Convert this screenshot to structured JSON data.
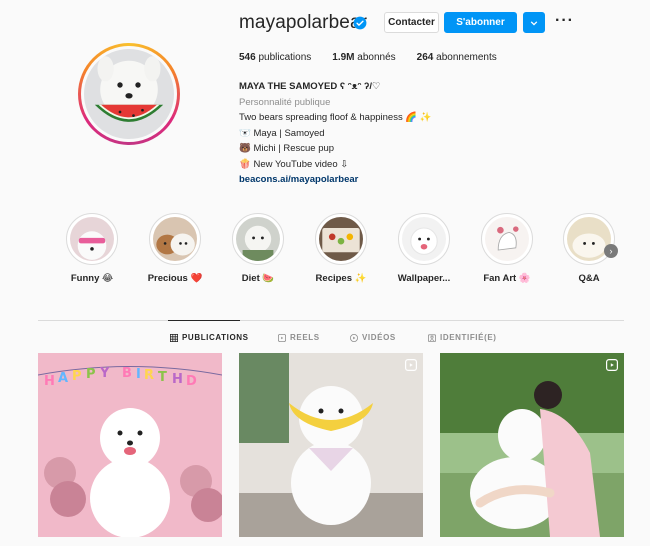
{
  "profile": {
    "username": "mayapolarbear",
    "contact_label": "Contacter",
    "follow_label": "S'abonner",
    "more_label": "···",
    "stats": [
      {
        "num": "546",
        "label": " publications"
      },
      {
        "num": "1.9M",
        "label": " abonnés"
      },
      {
        "num": "264",
        "label": " abonnements"
      }
    ],
    "bio": {
      "name": "MAYA THE SAMOYED ʕ ᵔᴥᵔ ʔ/♡",
      "category": "Personnalité publique",
      "lines": [
        "Two bears spreading floof & happiness 🌈 ✨",
        "🐻‍❄️ Maya | Samoyed",
        "🐻 Michi | Rescue pup",
        "🍿 New YouTube video ⇩"
      ],
      "link": "beacons.ai/mayapolarbear"
    }
  },
  "highlights": [
    {
      "label": "Funny 😂"
    },
    {
      "label": "Precious ❤️"
    },
    {
      "label": "Diet 🍉"
    },
    {
      "label": "Recipes ✨"
    },
    {
      "label": "Wallpaper..."
    },
    {
      "label": "Fan Art 🌸"
    },
    {
      "label": "Q&A"
    }
  ],
  "tabs": [
    {
      "label": "PUBLICATIONS",
      "icon": "grid-icon",
      "active": true
    },
    {
      "label": "REELS",
      "icon": "reels-icon"
    },
    {
      "label": "VIDÉOS",
      "icon": "video-icon"
    },
    {
      "label": "IDENTIFIÉ(E)",
      "icon": "tagged-icon"
    }
  ],
  "posts": [
    {
      "badge": null
    },
    {
      "badge": "reel-icon"
    },
    {
      "badge": "reel-icon"
    }
  ],
  "colors": {
    "accent": "#0095f6",
    "text": "#262626",
    "muted": "#8e8e8e",
    "link": "#00376b"
  }
}
